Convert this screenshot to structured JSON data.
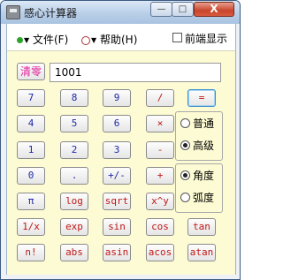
{
  "window": {
    "title": "感心计算器",
    "minimize_label": "—",
    "maximize_label": "□",
    "close_label": "X"
  },
  "menu": {
    "file_label": "文件(F)",
    "help_label": "帮助(H)",
    "topmost_label": "前端显示"
  },
  "display": {
    "value": "1001"
  },
  "buttons": {
    "clear": "清零",
    "n7": "7",
    "n8": "8",
    "n9": "9",
    "div": "/",
    "eq": "=",
    "n4": "4",
    "n5": "5",
    "n6": "6",
    "mul": "×",
    "n1": "1",
    "n2": "2",
    "n3": "3",
    "sub": "-",
    "n0": "0",
    "dot": ".",
    "neg": "+/-",
    "add": "+",
    "pi": "π",
    "log": "log",
    "sqrt": "sqrt",
    "pow": "x^y",
    "inv": "1/x",
    "exp": "exp",
    "sin": "sin",
    "cos": "cos",
    "tan": "tan",
    "fact": "n!",
    "abs": "abs",
    "asin": "asin",
    "acos": "acos",
    "atan": "atan"
  },
  "mode": {
    "normal_label": "普通",
    "advanced_label": "高级",
    "selected": "高级"
  },
  "angle": {
    "degree_label": "角度",
    "radian_label": "弧度",
    "selected": "角度"
  }
}
